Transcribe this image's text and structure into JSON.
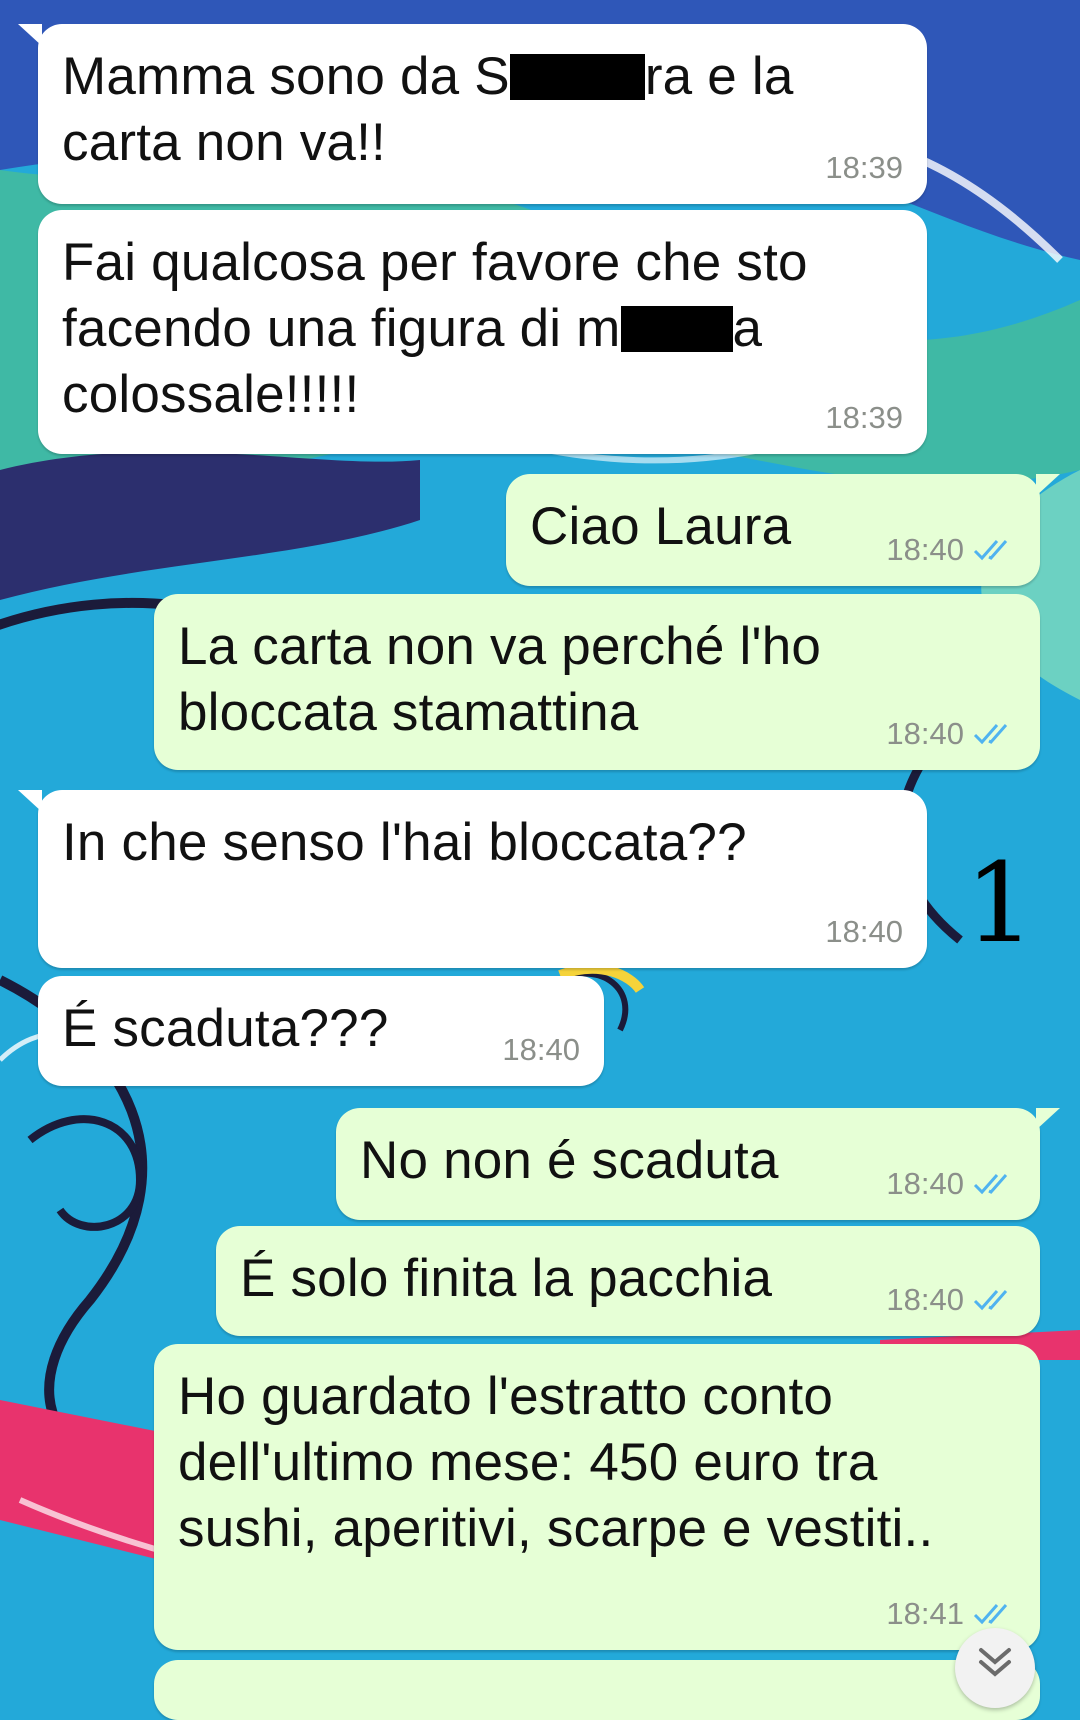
{
  "colors": {
    "incoming_bubble": "#ffffff",
    "outgoing_bubble": "#e6ffd6",
    "read_ticks": "#4fb3f0",
    "timestamp": "#8b8f8a",
    "wallpaper_base": "#23a9d9"
  },
  "messages": [
    {
      "direction": "in",
      "parts": [
        "Mamma sono da S",
        "[redacted]",
        "ra e la carta non va!!"
      ],
      "time": "18:39"
    },
    {
      "direction": "in",
      "parts": [
        "Fai qualcosa per favore che sto facendo una figura di m",
        "[redacted]",
        "a colossale!!!!!"
      ],
      "time": "18:39"
    },
    {
      "direction": "out",
      "text": "Ciao Laura",
      "time": "18:40",
      "status": "read"
    },
    {
      "direction": "out",
      "text": "La carta non va perché l'ho bloccata stamattina",
      "time": "18:40",
      "status": "read"
    },
    {
      "direction": "in",
      "text": "In che senso l'hai bloccata??",
      "time": "18:40"
    },
    {
      "direction": "in",
      "text": "É scaduta???",
      "time": "18:40"
    },
    {
      "direction": "out",
      "text": "No non é scaduta",
      "time": "18:40",
      "status": "read"
    },
    {
      "direction": "out",
      "text": "É solo finita la pacchia",
      "time": "18:40",
      "status": "read"
    },
    {
      "direction": "out",
      "text": "Ho guardato l'estratto conto dell'ultimo mese: 450 euro tra sushi, aperitivi, scarpe e vestiti..",
      "time": "18:41",
      "status": "read"
    }
  ],
  "annotation": "1",
  "icons": {
    "read_status": "double-check-icon",
    "scroll_down": "chevron-double-down-icon"
  }
}
